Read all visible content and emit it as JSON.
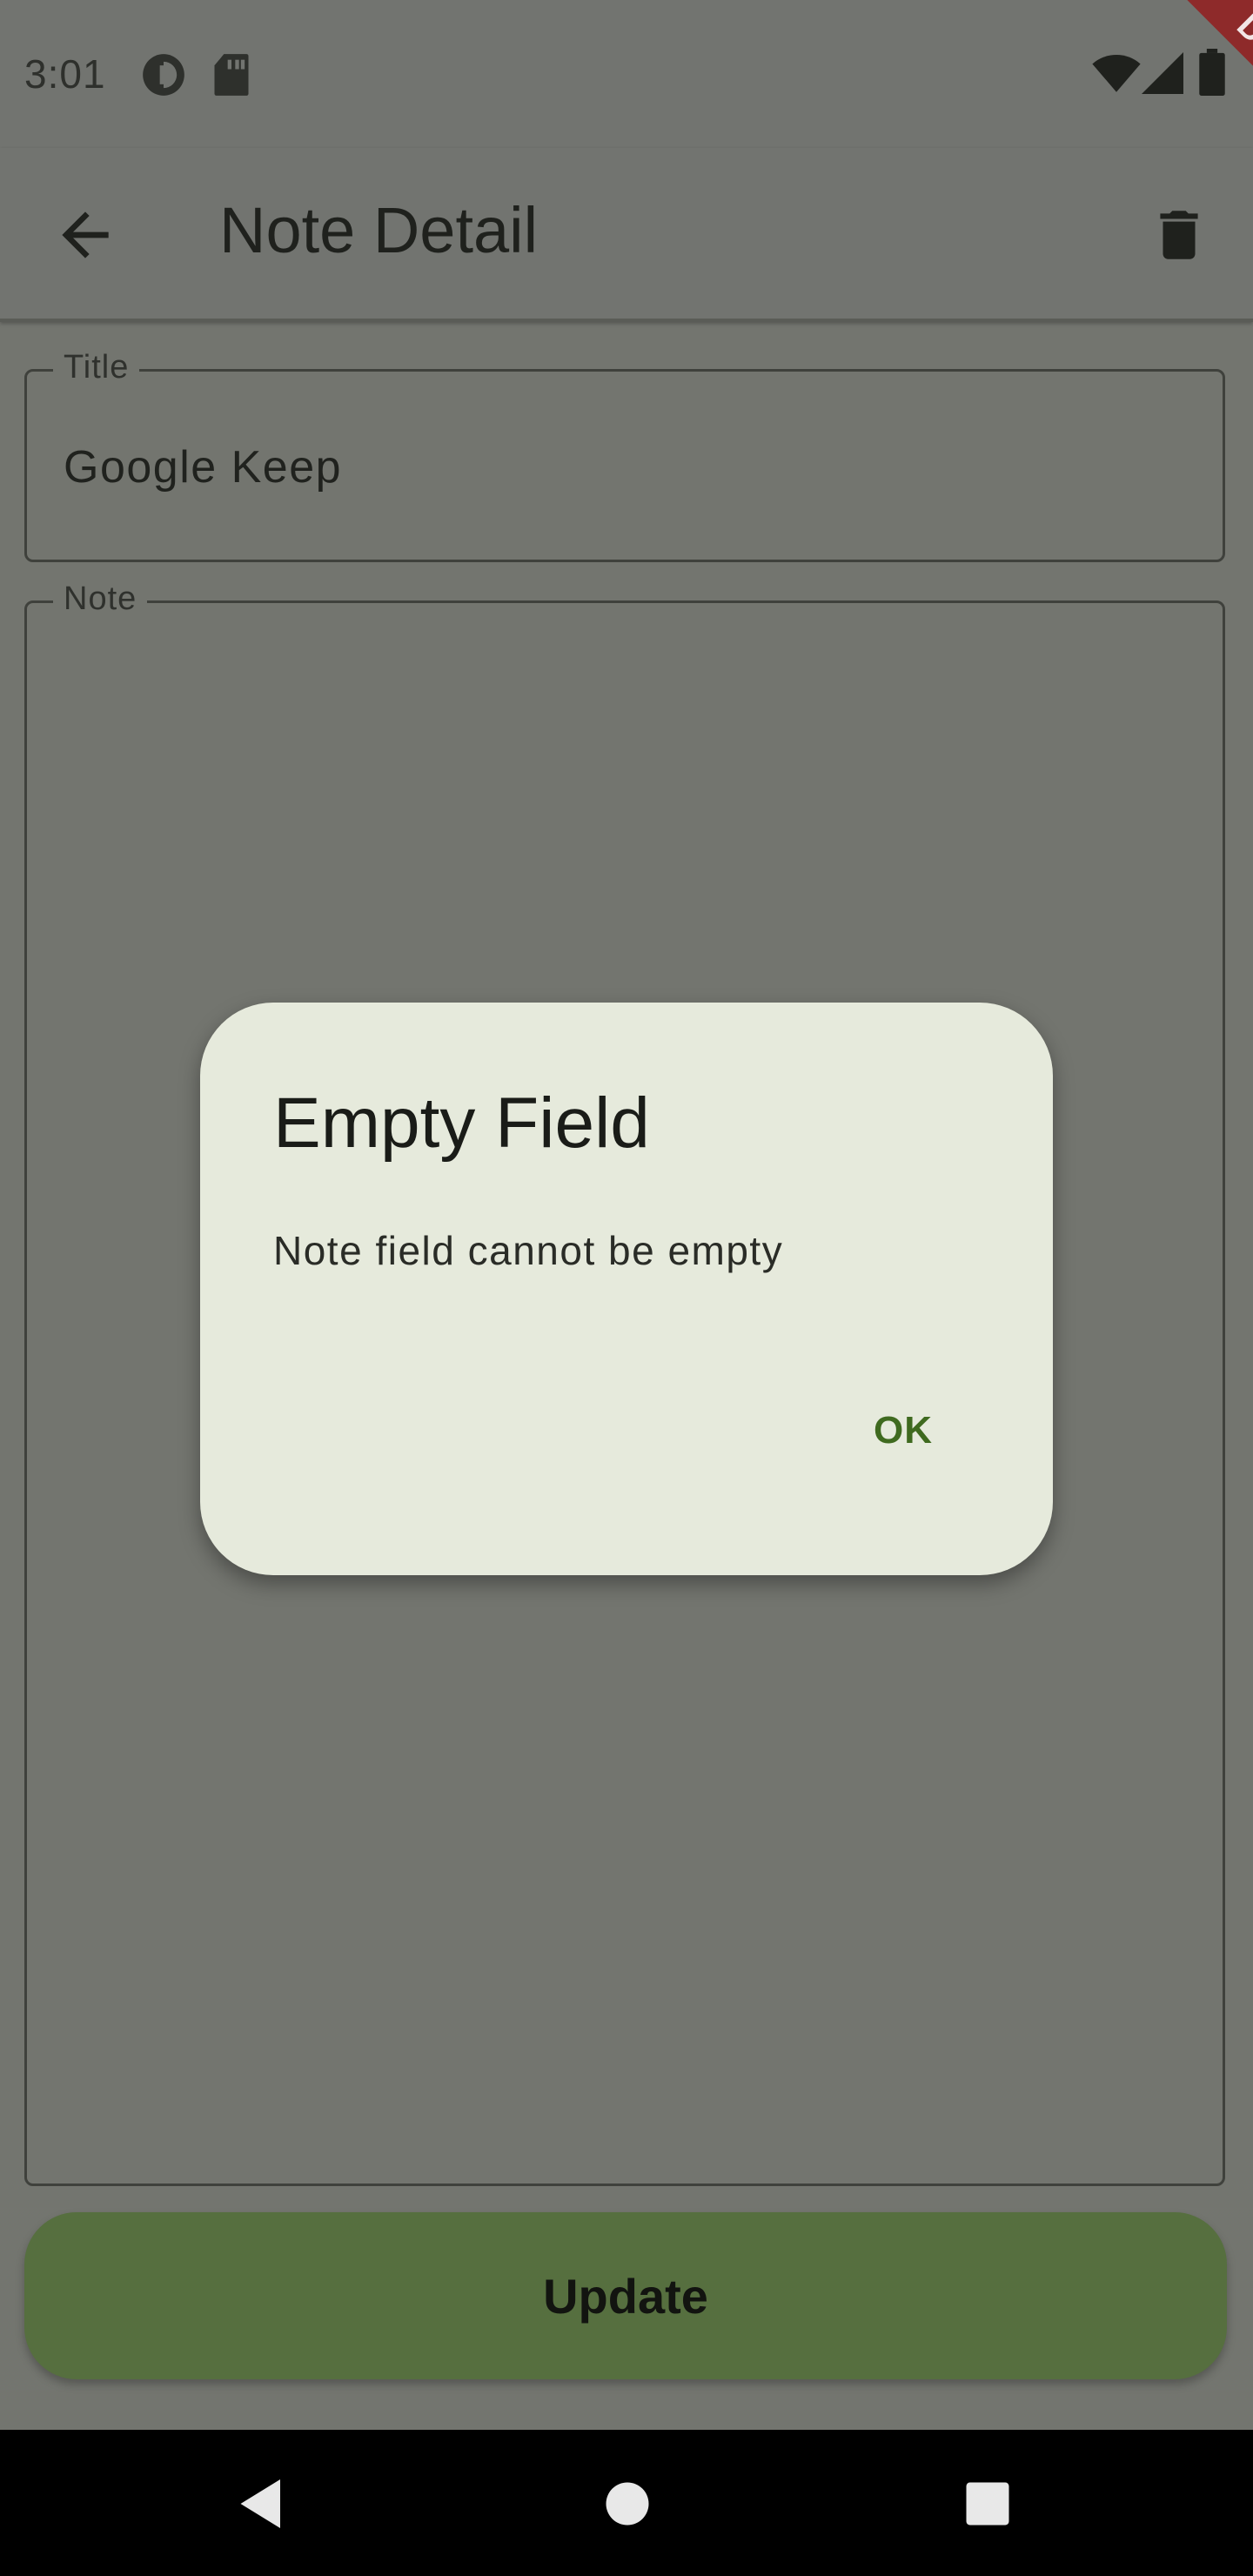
{
  "status_bar": {
    "time": "3:01",
    "left_icons": [
      "data-saver-icon",
      "sd-card-icon"
    ],
    "right_icons": [
      "wifi-icon",
      "signal-icon",
      "battery-icon"
    ]
  },
  "app_bar": {
    "title": "Note Detail",
    "back_icon": "arrow-left-icon",
    "delete_icon": "trash-icon"
  },
  "form": {
    "title_label": "Title",
    "title_value": "Google Keep",
    "note_label": "Note",
    "note_value": ""
  },
  "update_button": {
    "label": "Update",
    "color": "#566f3f"
  },
  "dialog": {
    "title": "Empty Field",
    "message": "Note field cannot be empty",
    "ok_label": "OK",
    "accent": "#3f6a1f"
  },
  "debug_banner": {
    "label": "DEBUG"
  },
  "nav_bar": {
    "icons": [
      "nav-back-icon",
      "nav-home-icon",
      "nav-recents-icon"
    ]
  }
}
